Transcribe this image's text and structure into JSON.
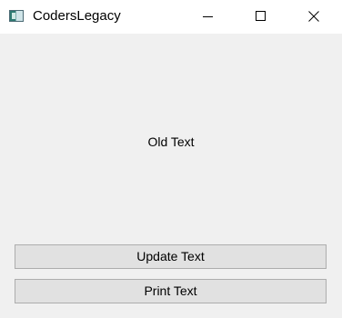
{
  "window": {
    "title": "CodersLegacy",
    "icon": "app-window-icon",
    "controls": {
      "minimize_icon": "minimize-icon",
      "maximize_icon": "maximize-icon",
      "close_icon": "close-icon"
    }
  },
  "main": {
    "label_text": "Old Text",
    "update_button_label": "Update Text",
    "print_button_label": "Print Text"
  },
  "colors": {
    "background": "#f0f0f0",
    "titlebar": "#ffffff",
    "button_face": "#e1e1e1",
    "button_border": "#adadad"
  }
}
